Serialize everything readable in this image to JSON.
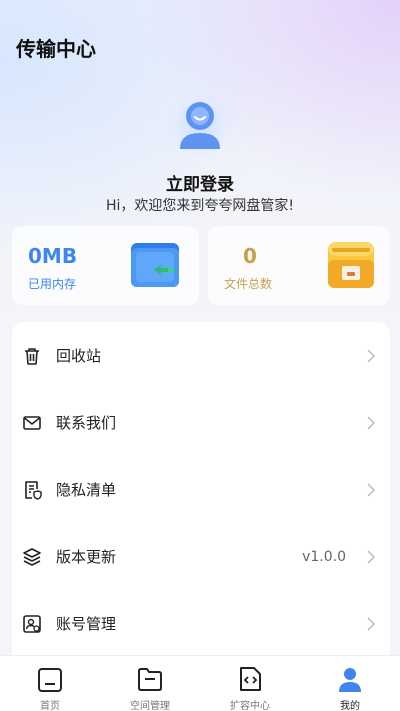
{
  "header": {
    "title": "传输中心"
  },
  "profile": {
    "login_label": "立即登录",
    "welcome": "Hi，欢迎您来到夸夸网盘管家!"
  },
  "stats": {
    "storage": {
      "value": "0MB",
      "label": "已用内存"
    },
    "files": {
      "value": "0",
      "label": "文件总数"
    }
  },
  "menu": {
    "items": [
      {
        "label": "回收站",
        "icon": "trash-icon"
      },
      {
        "label": "联系我们",
        "icon": "mail-icon"
      },
      {
        "label": "隐私清单",
        "icon": "privacy-list-icon"
      },
      {
        "label": "版本更新",
        "icon": "layers-icon",
        "value": "v1.0.0"
      },
      {
        "label": "账号管理",
        "icon": "account-manage-icon"
      }
    ]
  },
  "tabbar": {
    "tabs": [
      {
        "label": "首页",
        "icon": "home-icon"
      },
      {
        "label": "空间管理",
        "icon": "folder-icon"
      },
      {
        "label": "扩容中心",
        "icon": "code-file-icon"
      },
      {
        "label": "我的",
        "icon": "person-icon",
        "active": true
      }
    ]
  },
  "colors": {
    "accent_blue": "#3e86ee",
    "accent_gold": "#c8a04a",
    "folder_blue": "#3f8cf0",
    "folder_yellow": "#f7c744"
  }
}
